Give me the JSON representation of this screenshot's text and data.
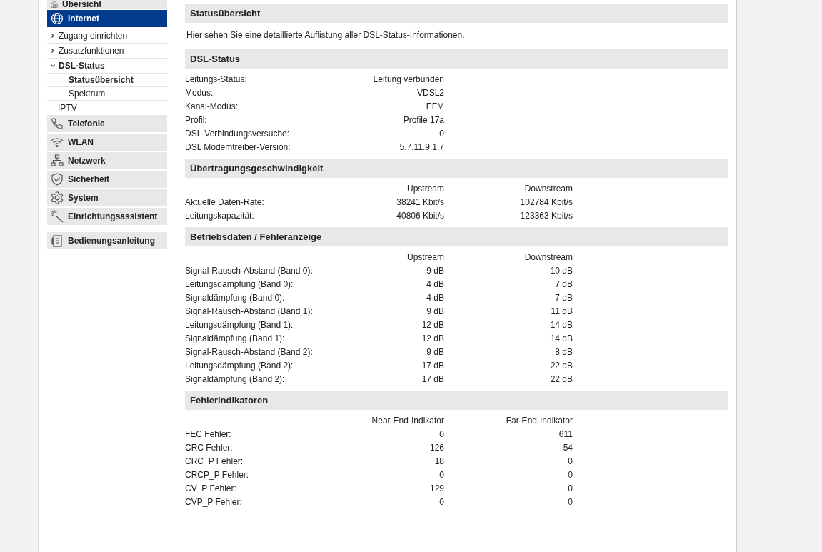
{
  "sidebar": {
    "items": [
      {
        "label": "Übersicht",
        "selected": false
      },
      {
        "label": "Internet",
        "selected": true,
        "children": [
          {
            "label": "Zugang einrichten",
            "expanded": false
          },
          {
            "label": "Zusatzfunktionen",
            "expanded": false
          },
          {
            "label": "DSL-Status",
            "expanded": true,
            "children": [
              {
                "label": "Statusübersicht",
                "selected": true
              },
              {
                "label": "Spektrum",
                "selected": false
              }
            ]
          },
          {
            "label": "IPTV"
          }
        ]
      },
      {
        "label": "Telefonie",
        "selected": false
      },
      {
        "label": "WLAN",
        "selected": false
      },
      {
        "label": "Netzwerk",
        "selected": false
      },
      {
        "label": "Sicherheit",
        "selected": false
      },
      {
        "label": "System",
        "selected": false
      },
      {
        "label": "Einrichtungsassistent",
        "selected": false
      }
    ],
    "manual": {
      "label": "Bedienungsanleitung"
    }
  },
  "sections": [
    {
      "title": "Statusübersicht",
      "text": "Hier sehen Sie eine detaillierte Auflistung aller DSL-Status-Informationen."
    },
    {
      "title": "DSL-Status",
      "rows": [
        {
          "label": "Leitungs-Status:",
          "values": [
            "Leitung verbunden"
          ]
        },
        {
          "label": "Modus:",
          "values": [
            "VDSL2"
          ]
        },
        {
          "label": "Kanal-Modus:",
          "values": [
            "EFM"
          ]
        },
        {
          "label": "Profil:",
          "values": [
            "Profile 17a"
          ]
        },
        {
          "label": "DSL-Verbindungsversuche:",
          "values": [
            "0"
          ]
        },
        {
          "label": "DSL Modemtreiber-Version:",
          "values": [
            "5.7.11.9.1.7"
          ]
        }
      ]
    },
    {
      "title": "Übertragungsgeschwindigkeit",
      "columns": [
        "Upstream",
        "Downstream"
      ],
      "rows": [
        {
          "label": "Aktuelle Daten-Rate:",
          "values": [
            "38241 Kbit/s",
            "102784 Kbit/s"
          ]
        },
        {
          "label": "Leitungskapazität:",
          "values": [
            "40806 Kbit/s",
            "123363 Kbit/s"
          ]
        }
      ]
    },
    {
      "title": "Betriebsdaten / Fehleranzeige",
      "columns": [
        "Upstream",
        "Downstream"
      ],
      "rows": [
        {
          "label": "Signal-Rausch-Abstand (Band 0):",
          "values": [
            "9 dB",
            "10 dB"
          ]
        },
        {
          "label": "Leitungsdämpfung (Band 0):",
          "values": [
            "4 dB",
            "7 dB"
          ]
        },
        {
          "label": "Signaldämpfung (Band 0):",
          "values": [
            "4 dB",
            "7 dB"
          ]
        },
        {
          "label": "Signal-Rausch-Abstand (Band 1):",
          "values": [
            "9 dB",
            "11 dB"
          ]
        },
        {
          "label": "Leitungsdämpfung (Band 1):",
          "values": [
            "12 dB",
            "14 dB"
          ]
        },
        {
          "label": "Signaldämpfung (Band 1):",
          "values": [
            "12 dB",
            "14 dB"
          ]
        },
        {
          "label": "Signal-Rausch-Abstand (Band 2):",
          "values": [
            "9 dB",
            "8 dB"
          ]
        },
        {
          "label": "Leitungsdämpfung (Band 2):",
          "values": [
            "17 dB",
            "22 dB"
          ]
        },
        {
          "label": "Signaldämpfung (Band 2):",
          "values": [
            "17 dB",
            "22 dB"
          ]
        }
      ]
    },
    {
      "title": "Fehlerindikatoren",
      "columns": [
        "Near-End-Indikator",
        "Far-End-Indikator"
      ],
      "rows": [
        {
          "label": "FEC Fehler:",
          "values": [
            "0",
            "611"
          ]
        },
        {
          "label": "CRC Fehler:",
          "values": [
            "126",
            "54"
          ]
        },
        {
          "label": "CRC_P Fehler:",
          "values": [
            "18",
            "0"
          ]
        },
        {
          "label": "CRCP_P Fehler:",
          "values": [
            "0",
            "0"
          ]
        },
        {
          "label": "CV_P Fehler:",
          "values": [
            "129",
            "0"
          ]
        },
        {
          "label": "CVP_P Fehler:",
          "values": [
            "0",
            "0"
          ]
        }
      ]
    }
  ]
}
